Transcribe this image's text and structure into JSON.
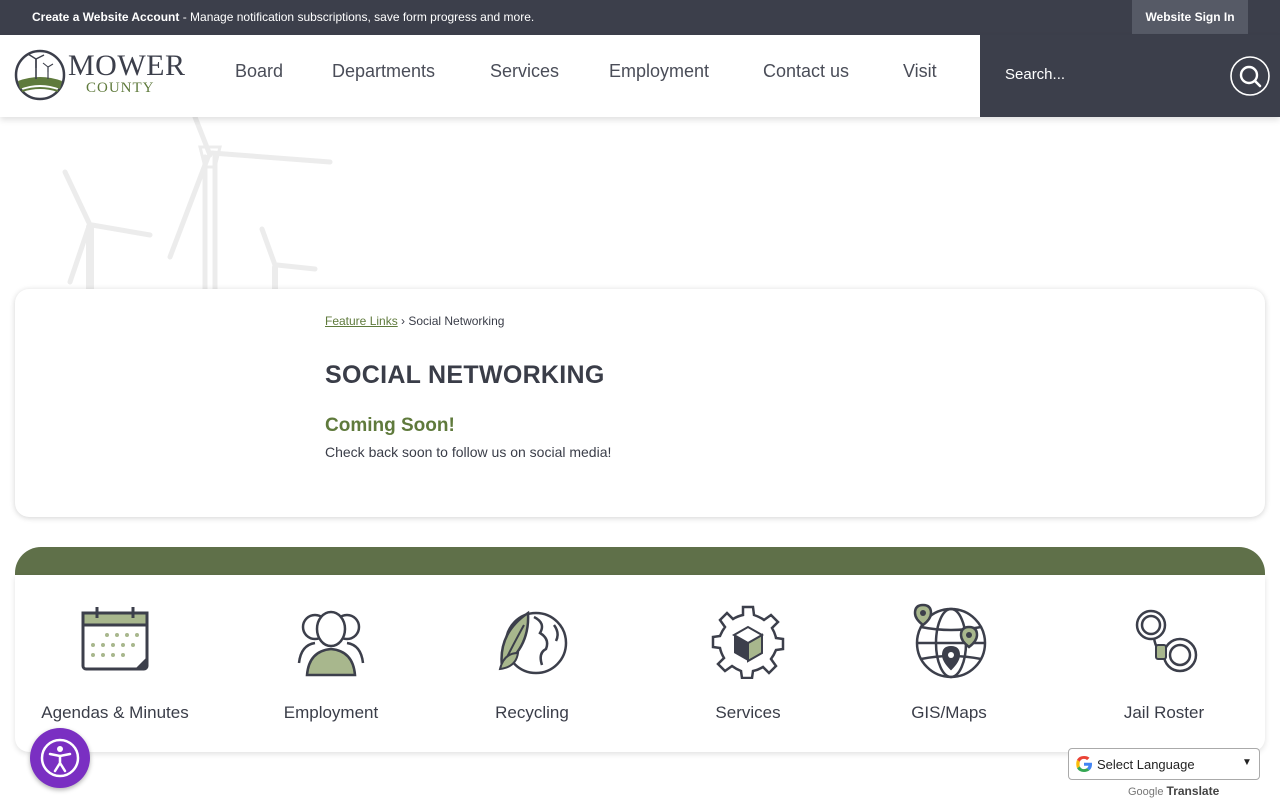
{
  "topbar": {
    "create_account": "Create a Website Account",
    "promo_text": " - Manage notification subscriptions, save form progress and more.",
    "sign_in": "Website Sign In"
  },
  "logo": {
    "line1": "MOWER",
    "line2": "COUNTY"
  },
  "nav": [
    "Board",
    "Departments",
    "Services",
    "Employment",
    "Contact us",
    "Visit"
  ],
  "search": {
    "placeholder": "Search..."
  },
  "breadcrumb": {
    "parent": "Feature Links",
    "separator": " › ",
    "current": "Social Networking"
  },
  "page": {
    "title": "SOCIAL NETWORKING",
    "subtitle": "Coming Soon!",
    "text": "Check back soon to follow us on social media!"
  },
  "quick_links": [
    {
      "label": "Agendas & Minutes",
      "icon": "calendar-icon"
    },
    {
      "label": "Employment",
      "icon": "people-icon"
    },
    {
      "label": "Recycling",
      "icon": "globe-leaf-icon"
    },
    {
      "label": "Services",
      "icon": "gear-box-icon"
    },
    {
      "label": "GIS/Maps",
      "icon": "globe-pin-icon"
    },
    {
      "label": "Jail Roster",
      "icon": "handcuffs-icon"
    }
  ],
  "translate": {
    "label": "Select Language",
    "powered_by": "Google",
    "translate_word": "Translate"
  },
  "colors": {
    "dark": "#3c3f4b",
    "green": "#5f7a3c",
    "band": "#5f7049",
    "accessibility": "#7a2fc2"
  }
}
